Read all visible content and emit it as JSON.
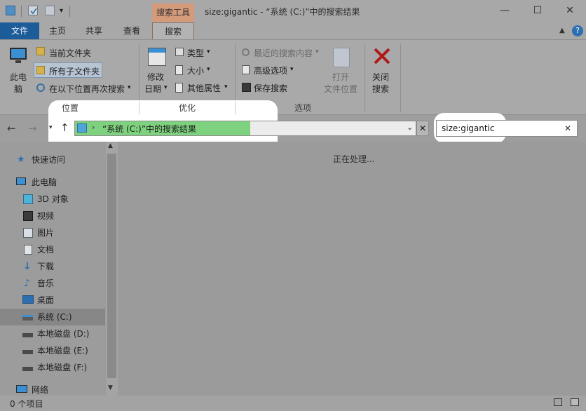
{
  "window": {
    "title": "size:gigantic - “系统 (C:)”中的搜索结果",
    "contextual_header": "搜索工具"
  },
  "tabs": {
    "file": "文件",
    "home": "主页",
    "share": "共享",
    "view": "查看",
    "search": "搜索"
  },
  "ribbon": {
    "location": {
      "this_pc": [
        "此电",
        "脑"
      ],
      "current_folder": "当前文件夹",
      "all_subfolders": "所有子文件夹",
      "search_again": "在以下位置再次搜索",
      "label": "位置"
    },
    "refine": {
      "date_modified": [
        "修改",
        "日期"
      ],
      "kind": "类型",
      "size": "大小",
      "other_props": "其他属性",
      "label": "优化"
    },
    "options": {
      "recent_searches": "最近的搜索内容",
      "advanced_options": "高级选项",
      "save_search": "保存搜索",
      "open_location": [
        "打开",
        "文件位置"
      ],
      "close_search": [
        "关闭",
        "搜索"
      ],
      "label": "选项"
    }
  },
  "address": {
    "path": "“系统 (C:)”中的搜索结果"
  },
  "search": {
    "value": "size:gigantic"
  },
  "nav": {
    "items": [
      {
        "label": "快速访问",
        "icon": "star-icon"
      },
      {
        "label": "此电脑",
        "icon": "computer-icon"
      },
      {
        "label": "3D 对象",
        "icon": "cube-icon"
      },
      {
        "label": "视频",
        "icon": "video-icon"
      },
      {
        "label": "图片",
        "icon": "picture-icon"
      },
      {
        "label": "文档",
        "icon": "document-icon"
      },
      {
        "label": "下载",
        "icon": "download-icon"
      },
      {
        "label": "音乐",
        "icon": "music-icon"
      },
      {
        "label": "桌面",
        "icon": "desktop-icon"
      },
      {
        "label": "系统 (C:)",
        "icon": "system-drive-icon"
      },
      {
        "label": "本地磁盘 (D:)",
        "icon": "drive-icon"
      },
      {
        "label": "本地磁盘 (E:)",
        "icon": "drive-icon"
      },
      {
        "label": "本地磁盘 (F:)",
        "icon": "drive-icon"
      },
      {
        "label": "网络",
        "icon": "network-icon"
      }
    ]
  },
  "content": {
    "status_message": "正在处理..."
  },
  "statusbar": {
    "count": "0 个项目"
  }
}
